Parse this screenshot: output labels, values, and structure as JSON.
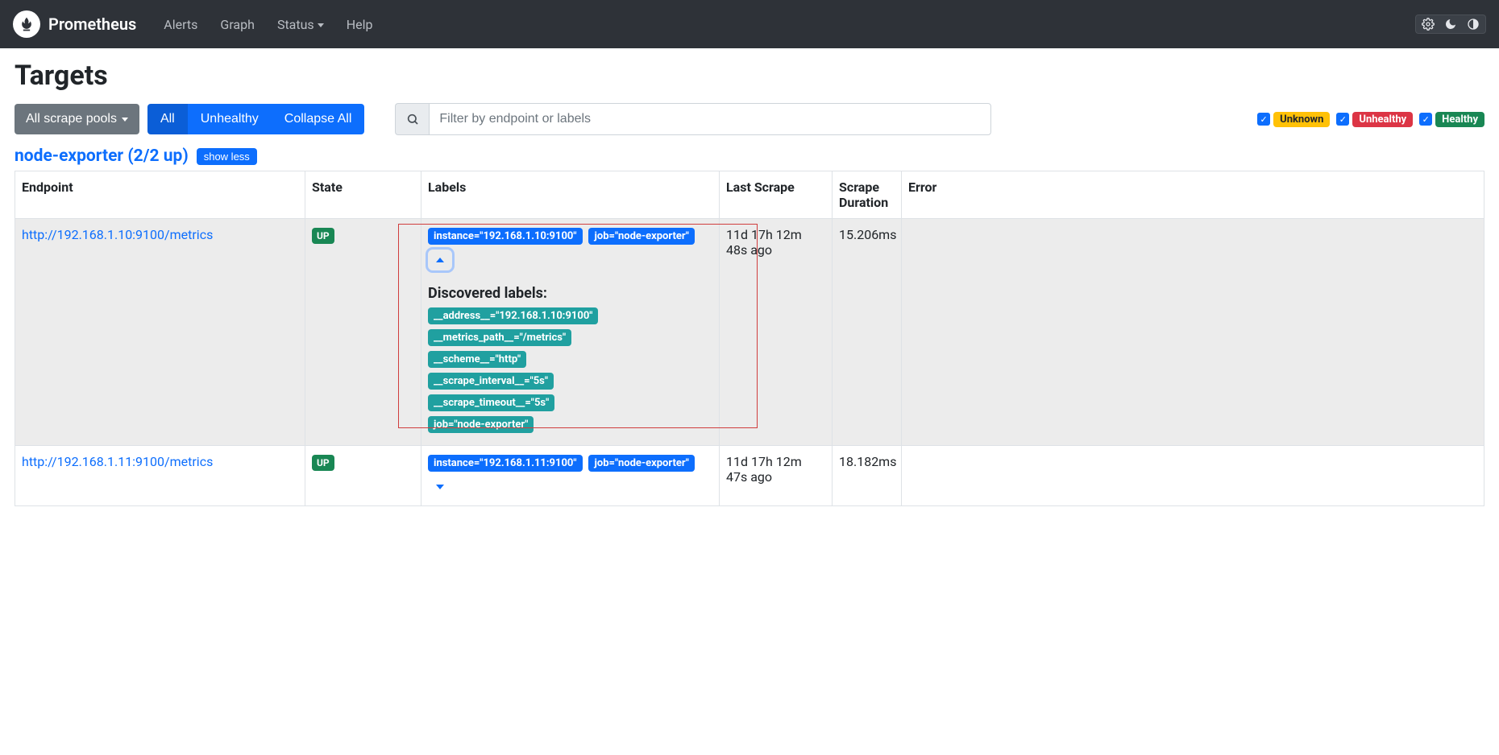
{
  "brand": "Prometheus",
  "nav": {
    "alerts": "Alerts",
    "graph": "Graph",
    "status": "Status",
    "help": "Help"
  },
  "page_title": "Targets",
  "controls": {
    "pool_selector": "All scrape pools",
    "pill_all": "All",
    "pill_unhealthy": "Unhealthy",
    "pill_collapse": "Collapse All",
    "search_placeholder": "Filter by endpoint or labels"
  },
  "legend": {
    "unknown": "Unknown",
    "unhealthy": "Unhealthy",
    "healthy": "Healthy"
  },
  "pool": {
    "title": "node-exporter (2/2 up)",
    "toggle": "show less"
  },
  "columns": {
    "endpoint": "Endpoint",
    "state": "State",
    "labels": "Labels",
    "last_scrape": "Last Scrape",
    "scrape_duration": "Scrape Duration",
    "error": "Error"
  },
  "rows": [
    {
      "endpoint": "http://192.168.1.10:9100/metrics",
      "state": "UP",
      "labels": {
        "instance": "instance=\"192.168.1.10:9100\"",
        "job": "job=\"node-exporter\""
      },
      "expanded": true,
      "discovered_title": "Discovered labels:",
      "discovered": [
        "__address__=\"192.168.1.10:9100\"",
        "__metrics_path__=\"/metrics\"",
        "__scheme__=\"http\"",
        "__scrape_interval__=\"5s\"",
        "__scrape_timeout__=\"5s\"",
        "job=\"node-exporter\""
      ],
      "last_scrape": "11d 17h 12m 48s ago",
      "duration": "15.206ms",
      "error": ""
    },
    {
      "endpoint": "http://192.168.1.11:9100/metrics",
      "state": "UP",
      "labels": {
        "instance": "instance=\"192.168.1.11:9100\"",
        "job": "job=\"node-exporter\""
      },
      "expanded": false,
      "last_scrape": "11d 17h 12m 47s ago",
      "duration": "18.182ms",
      "error": ""
    }
  ]
}
